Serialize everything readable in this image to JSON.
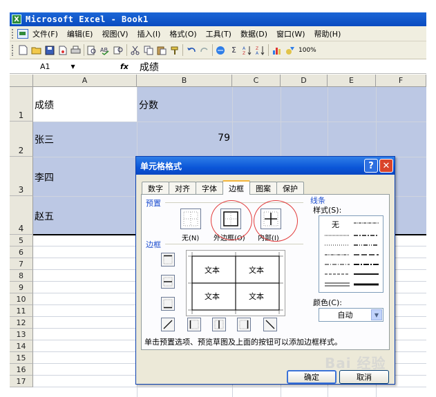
{
  "app": {
    "icon_letter": "X",
    "window_title": "Microsoft Excel - Book1"
  },
  "menu": [
    "文件(F)",
    "编辑(E)",
    "视图(V)",
    "插入(I)",
    "格式(O)",
    "工具(T)",
    "数据(D)",
    "窗口(W)",
    "帮助(H)"
  ],
  "toolbar": {
    "zoom": "100%",
    "sum_glyph": "Σ"
  },
  "formula_bar": {
    "name_box": "A1",
    "fx_label": "fx",
    "value": "成绩"
  },
  "columns": [
    "A",
    "B",
    "C",
    "D",
    "E",
    "F"
  ],
  "rows": [
    "1",
    "2",
    "3",
    "4",
    "5",
    "6",
    "7",
    "8",
    "9",
    "10",
    "11",
    "12",
    "13",
    "14",
    "15",
    "16",
    "17"
  ],
  "cells": {
    "a1": "成绩",
    "b1": "分数",
    "a2": "张三",
    "b2": "79",
    "a3": "李四",
    "a4": "赵五"
  },
  "dialog": {
    "title": "单元格格式",
    "help": "?",
    "close": "✕",
    "tabs": [
      "数字",
      "对齐",
      "字体",
      "边框",
      "图案",
      "保护"
    ],
    "active_tab": "边框",
    "preset_group": "预置",
    "presets": [
      "无(N)",
      "外边框(O)",
      "内部(I)"
    ],
    "border_group": "边框",
    "preview_text": "文本",
    "line_group": "线条",
    "style_label": "样式(S):",
    "none_label": "无",
    "color_label": "颜色(C):",
    "color_value": "自动",
    "hint": "单击预置选项、预览草图及上面的按钮可以添加边框样式。",
    "ok": "确定",
    "cancel": "取消"
  },
  "watermark": "Bai 经验"
}
